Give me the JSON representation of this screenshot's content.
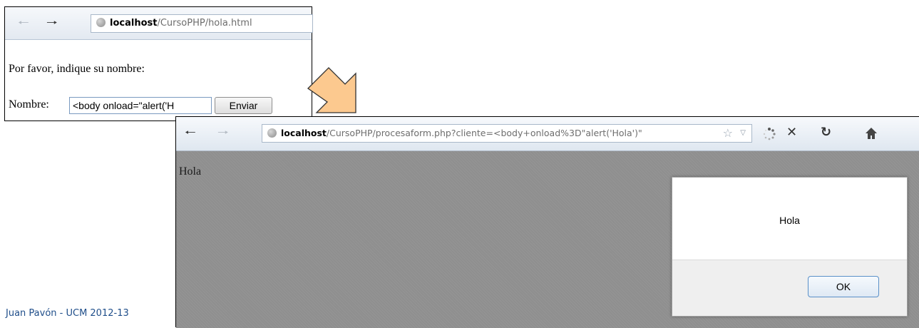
{
  "window1": {
    "url_host": "localhost",
    "url_path": "/CursoPHP/hola.html",
    "prompt_text": "Por favor, indique su nombre:",
    "name_label": "Nombre:",
    "name_input_value": "<body onload=\"alert('H",
    "submit_label": "Enviar"
  },
  "window2": {
    "url_host": "localhost",
    "url_path": "/CursoPHP/procesaform.php?cliente=<body+onload%3D\"alert('Hola')\"",
    "page_text": "Hola",
    "alert_message": "Hola",
    "ok_label": "OK"
  },
  "icons": {
    "back": "arrow-left",
    "forward": "arrow-right",
    "stop": "close",
    "reload": "reload",
    "home": "home",
    "bookmark": "star",
    "dropdown": "chevron-down",
    "loading": "spinner"
  },
  "footer": "Juan Pavón - UCM 2012-13",
  "colors": {
    "arrow_fill": "#fcc98f",
    "page_background": "#8f8f8f",
    "footer_text": "#1f4e8a"
  }
}
